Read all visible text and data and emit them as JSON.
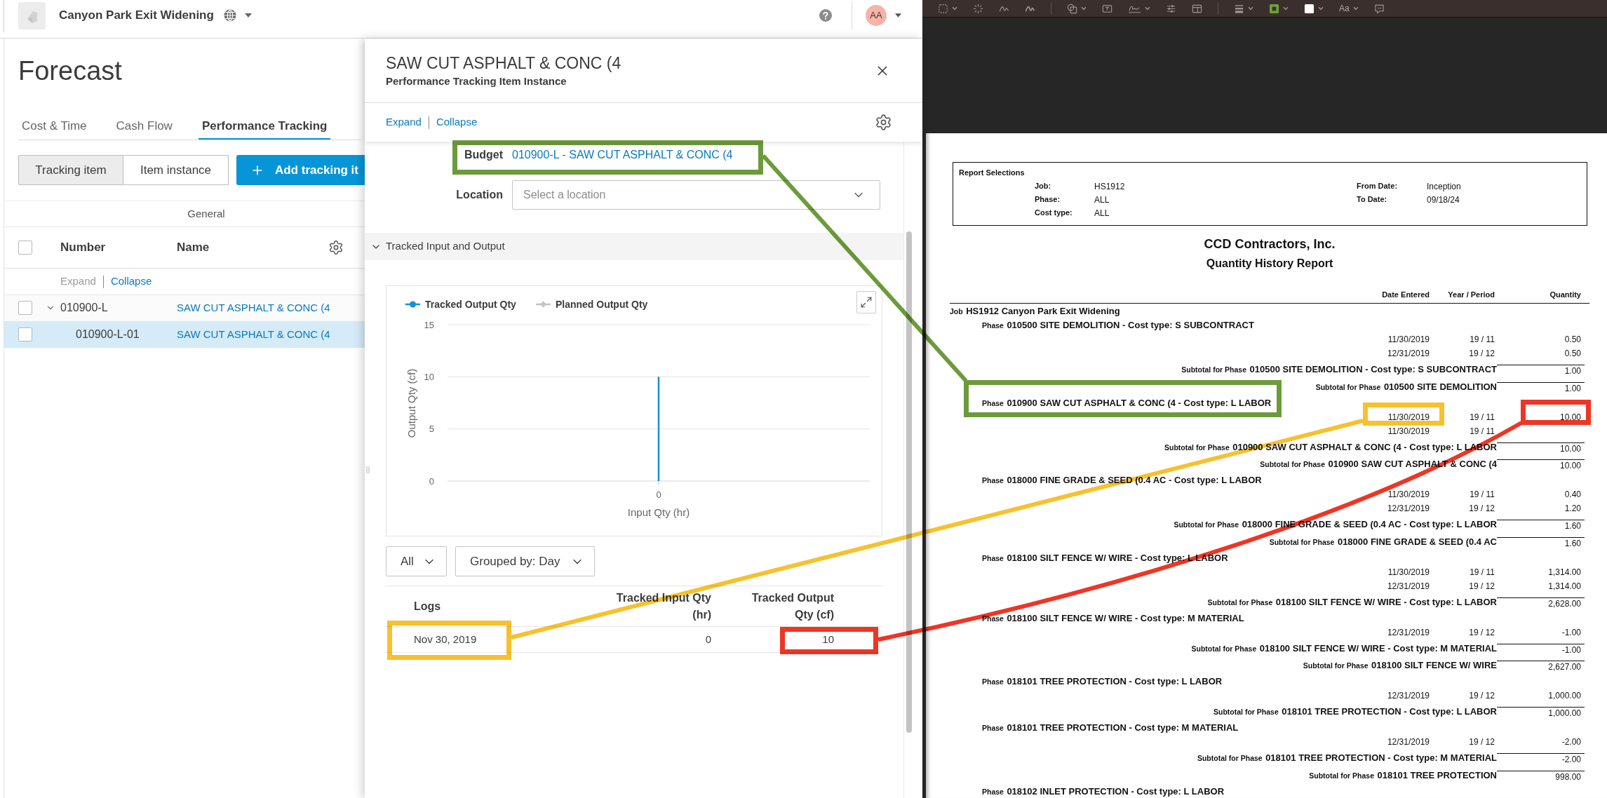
{
  "app": {
    "header": {
      "project": "Canyon Park Exit Widening",
      "avatar": "AA"
    },
    "page_title": "Forecast",
    "tabs": [
      {
        "label": "Cost & Time",
        "selected": false
      },
      {
        "label": "Cash Flow",
        "selected": false
      },
      {
        "label": "Performance Tracking",
        "selected": true
      }
    ],
    "view_toggle": [
      {
        "label": "Tracking item",
        "selected": true
      },
      {
        "label": "Item instance",
        "selected": false
      }
    ],
    "add_button": "Add tracking it",
    "table": {
      "group_header": "General",
      "columns": [
        "Number",
        "Name"
      ],
      "all_checked": false,
      "expand": {
        "label": "Expand",
        "disabled": true
      },
      "collapse": {
        "label": "Collapse",
        "disabled": false
      },
      "rows": [
        {
          "number": "010900-L",
          "name": "SAW CUT ASPHALT & CONC (4",
          "checked": false,
          "selected": false,
          "expanded": true,
          "children": [
            {
              "number": "010900-L-01",
              "name": "SAW CUT ASPHALT & CONC (4",
              "checked": false,
              "selected": true
            }
          ]
        }
      ]
    }
  },
  "panel": {
    "title": "SAW CUT ASPHALT & CONC (4",
    "subtitle": "Performance Tracking Item Instance",
    "expand": {
      "label": "Expand",
      "disabled": false
    },
    "collapse": {
      "label": "Collapse",
      "disabled": false
    },
    "fields": [
      {
        "kind": "link",
        "label": "Budget",
        "value": "010900-L - SAW CUT ASPHALT & CONC (4"
      },
      {
        "kind": "select",
        "label": "Location",
        "placeholder": "Select a location"
      }
    ],
    "section": {
      "title": "Tracked Input and Output",
      "expanded": true,
      "chart_data": {
        "type": "bar",
        "xlabel": "Input Qty (hr)",
        "ylabel": "Output Qty (cf)",
        "categories": [
          "0"
        ],
        "series": [
          {
            "name": "Tracked Output Qty",
            "color": "#1a8fd6",
            "values": [
              10
            ]
          },
          {
            "name": "Planned Output Qty",
            "color": "#c4c4c4",
            "values": [
              null
            ]
          }
        ],
        "ylim": [
          0,
          15
        ],
        "yticks": [
          0,
          5,
          10,
          15
        ]
      },
      "filters": [
        {
          "label": "All"
        },
        {
          "label": "Grouped by: Day"
        }
      ],
      "logs": {
        "columns": [
          "Logs",
          "Tracked Input Qty (hr)",
          "Tracked Output Qty (cf)"
        ],
        "rows": [
          [
            "Nov 30, 2019",
            "0",
            "10"
          ]
        ]
      }
    }
  },
  "pdf_viewer": {
    "toolbar": [
      {
        "kind": "selection",
        "menu": true
      },
      {
        "kind": "magic",
        "menu": false
      },
      {
        "kind": "sketch",
        "menu": false
      },
      {
        "kind": "draw",
        "menu": false
      },
      {
        "kind": "separator"
      },
      {
        "kind": "shapes",
        "menu": true
      },
      {
        "kind": "textbox",
        "menu": false
      },
      {
        "kind": "sign",
        "menu": true
      },
      {
        "kind": "adjust",
        "menu": false
      },
      {
        "kind": "layout",
        "menu": false
      },
      {
        "kind": "separator"
      },
      {
        "kind": "line-style",
        "menu": true
      },
      {
        "kind": "border-color",
        "color": "#6aa23a",
        "menu": true
      },
      {
        "kind": "fill-color",
        "color": "#ffffff",
        "menu": true
      },
      {
        "kind": "font",
        "label": "Aa",
        "menu": true
      },
      {
        "kind": "note",
        "menu": false
      }
    ],
    "report": {
      "selections": {
        "title": "Report Selections",
        "left": [
          {
            "label": "Job:",
            "value": "HS1912"
          },
          {
            "label": "Phase:",
            "value": "ALL"
          },
          {
            "label": "Cost type:",
            "value": "ALL"
          }
        ],
        "right": [
          {
            "label": "From Date:",
            "value": "Inception"
          },
          {
            "label": "To Date:",
            "value": "09/18/24"
          }
        ]
      },
      "company": "CCD Contractors, Inc.",
      "title": "Quantity History Report",
      "columns": [
        "Date Entered",
        "Year / Period",
        "Quantity"
      ],
      "lines": [
        {
          "kind": "job",
          "prefix": "Job",
          "text": "HS1912 Canyon Park Exit Widening"
        },
        {
          "kind": "phase",
          "prefix": "Phase",
          "text": "010500 SITE DEMOLITION - Cost type: S SUBCONTRACT"
        },
        {
          "kind": "entry",
          "date": "11/30/2019",
          "period": "19 / 11",
          "quantity": "0.50"
        },
        {
          "kind": "entry",
          "date": "12/31/2019",
          "period": "19 / 12",
          "quantity": "0.50"
        },
        {
          "kind": "subtotal",
          "prefix": "Subtotal for Phase",
          "text": "010500 SITE DEMOLITION - Cost type: S SUBCONTRACT",
          "quantity": "1.00"
        },
        {
          "kind": "subtotal",
          "prefix": "Subtotal for Phase",
          "text": "010500 SITE DEMOLITION",
          "quantity": "1.00"
        },
        {
          "kind": "phase",
          "prefix": "Phase",
          "text": "010900 SAW CUT ASPHALT & CONC (4 - Cost type: L LABOR"
        },
        {
          "kind": "entry",
          "date": "11/30/2019",
          "period": "19 / 11",
          "quantity": "10.00"
        },
        {
          "kind": "entry",
          "date": "11/30/2019",
          "period": "19 / 11"
        },
        {
          "kind": "subtotal",
          "prefix": "Subtotal for Phase",
          "text": "010900 SAW CUT ASPHALT & CONC (4 - Cost type: L LABOR",
          "quantity": "10.00"
        },
        {
          "kind": "subtotal",
          "prefix": "Subtotal for Phase",
          "text": "010900 SAW CUT ASPHALT & CONC (4",
          "quantity": "10.00"
        },
        {
          "kind": "phase",
          "prefix": "Phase",
          "text": "018000 FINE GRADE & SEED (0.4 AC - Cost type: L LABOR"
        },
        {
          "kind": "entry",
          "date": "11/30/2019",
          "period": "19 / 11",
          "quantity": "0.40"
        },
        {
          "kind": "entry",
          "date": "12/31/2019",
          "period": "19 / 12",
          "quantity": "1.20"
        },
        {
          "kind": "subtotal",
          "prefix": "Subtotal for Phase",
          "text": "018000 FINE GRADE & SEED (0.4 AC - Cost type: L LABOR",
          "quantity": "1.60"
        },
        {
          "kind": "subtotal",
          "prefix": "Subtotal for Phase",
          "text": "018000 FINE GRADE & SEED (0.4 AC",
          "quantity": "1.60"
        },
        {
          "kind": "phase",
          "prefix": "Phase",
          "text": "018100 SILT FENCE W/ WIRE - Cost type: L LABOR"
        },
        {
          "kind": "entry",
          "date": "11/30/2019",
          "period": "19 / 11",
          "quantity": "1,314.00"
        },
        {
          "kind": "entry",
          "date": "12/31/2019",
          "period": "19 / 12",
          "quantity": "1,314.00"
        },
        {
          "kind": "subtotal",
          "prefix": "Subtotal for Phase",
          "text": "018100 SILT FENCE W/ WIRE - Cost type: L LABOR",
          "quantity": "2,628.00"
        },
        {
          "kind": "phase",
          "prefix": "Phase",
          "text": "018100 SILT FENCE W/ WIRE - Cost type: M MATERIAL"
        },
        {
          "kind": "entry",
          "date": "12/31/2019",
          "period": "19 / 12",
          "quantity": "-1.00"
        },
        {
          "kind": "subtotal",
          "prefix": "Subtotal for Phase",
          "text": "018100 SILT FENCE W/ WIRE - Cost type: M MATERIAL",
          "quantity": "-1.00"
        },
        {
          "kind": "subtotal",
          "prefix": "Subtotal for Phase",
          "text": "018100 SILT FENCE W/ WIRE",
          "quantity": "2,627.00"
        },
        {
          "kind": "phase",
          "prefix": "Phase",
          "text": "018101 TREE PROTECTION - Cost type: L LABOR"
        },
        {
          "kind": "entry",
          "date": "12/31/2019",
          "period": "19 / 12",
          "quantity": "1,000.00"
        },
        {
          "kind": "subtotal",
          "prefix": "Subtotal for Phase",
          "text": "018101 TREE PROTECTION - Cost type: L LABOR",
          "quantity": "1,000.00"
        },
        {
          "kind": "phase",
          "prefix": "Phase",
          "text": "018101 TREE PROTECTION - Cost type: M MATERIAL"
        },
        {
          "kind": "entry",
          "date": "12/31/2019",
          "period": "19 / 12",
          "quantity": "-2.00"
        },
        {
          "kind": "subtotal",
          "prefix": "Subtotal for Phase",
          "text": "018101 TREE PROTECTION - Cost type: M MATERIAL",
          "quantity": "-2.00"
        },
        {
          "kind": "subtotal",
          "prefix": "Subtotal for Phase",
          "text": "018101 TREE PROTECTION",
          "quantity": "998.00"
        },
        {
          "kind": "phase",
          "prefix": "Phase",
          "text": "018102 INLET PROTECTION - Cost type: L LABOR"
        }
      ]
    }
  },
  "annotations": [
    {
      "color": "#6c9b3c"
    },
    {
      "color": "#f7c12e"
    },
    {
      "color": "#ef3524"
    }
  ]
}
